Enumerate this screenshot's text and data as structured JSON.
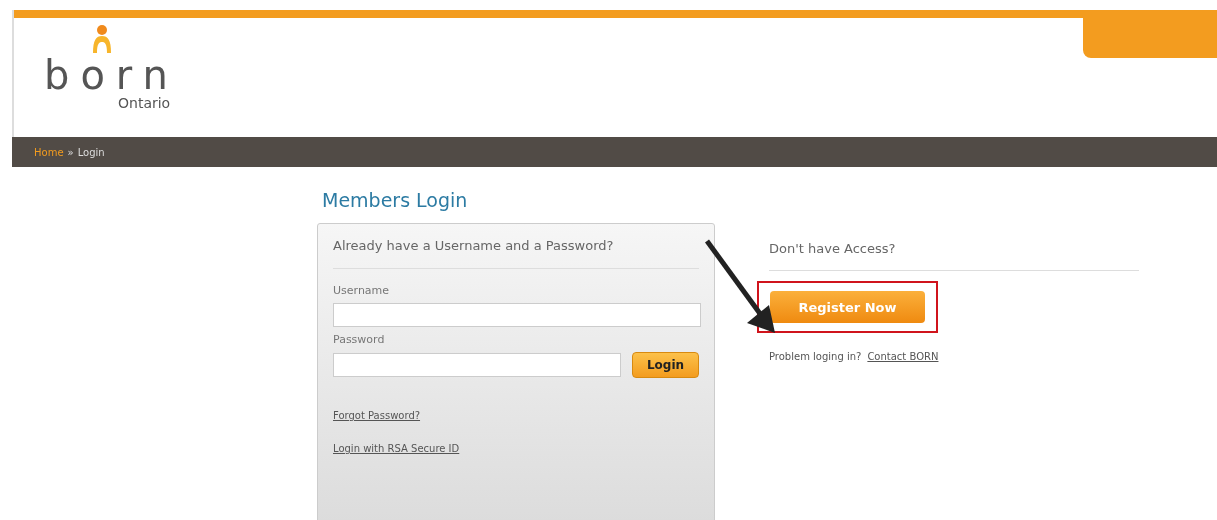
{
  "logo": {
    "word": "born",
    "region": "Ontario"
  },
  "breadcrumb": [
    {
      "label": "Home",
      "kind": "link"
    },
    {
      "label": "»",
      "kind": "separator"
    },
    {
      "label": "Login",
      "kind": "current"
    }
  ],
  "title": "Members Login",
  "login_panel": {
    "heading": "Already have a Username and a Password?",
    "fields": [
      {
        "label": "Username"
      },
      {
        "label": "Password"
      }
    ],
    "submit": "Login",
    "links": [
      "Forgot Password?",
      "Login with RSA Secure ID"
    ]
  },
  "register": {
    "heading": "Don't have Access?",
    "button": "Register Now",
    "highlighted": true,
    "help": "Problem loging in?",
    "help_link": "Contact BORN"
  }
}
